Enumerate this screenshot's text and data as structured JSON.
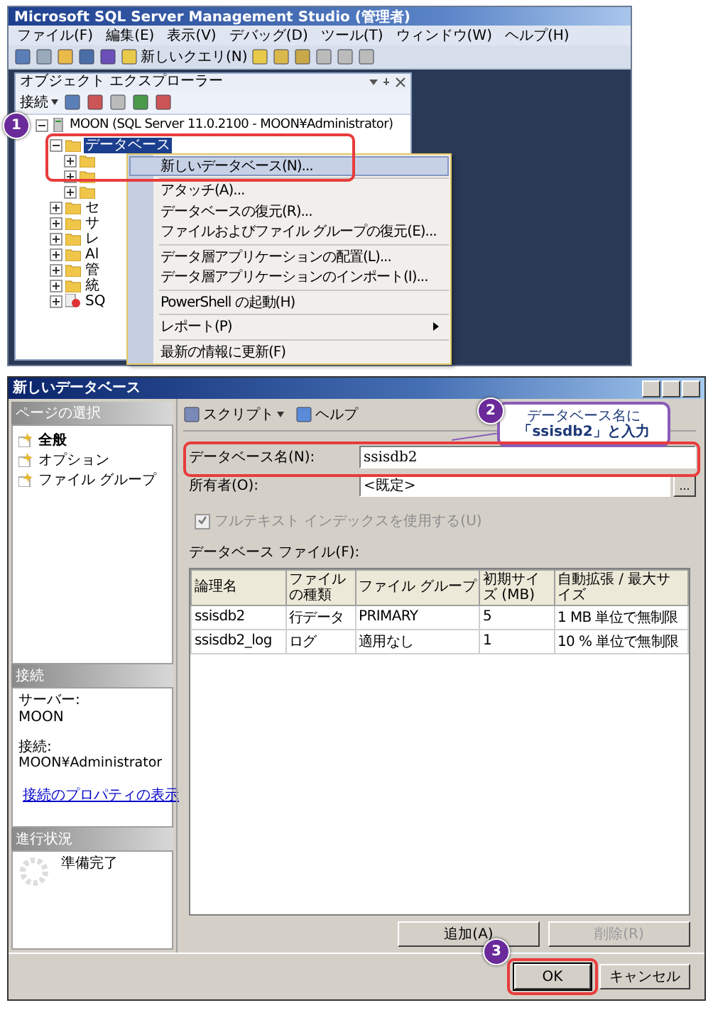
{
  "ssms": {
    "title": "Microsoft SQL Server Management Studio (管理者)",
    "menu": [
      "ファイル(F)",
      "編集(E)",
      "表示(V)",
      "デバッグ(D)",
      "ツール(T)",
      "ウィンドウ(W)",
      "ヘルプ(H)"
    ],
    "new_query": "新しいクエリ(N)",
    "explorer": {
      "title": "オブジェクト エクスプローラー",
      "connect": "接続",
      "tree": {
        "label": "MOON (SQL Server 11.0.2100 - MOON¥Administrator)",
        "kind": "server",
        "expanded": true,
        "selected": false,
        "children": [
          {
            "label": "データベース",
            "kind": "folder",
            "expanded": true,
            "selected": true
          },
          {
            "label": "セ",
            "kind": "folder",
            "expanded": false,
            "selected": false
          },
          {
            "label": "サ",
            "kind": "folder",
            "expanded": false,
            "selected": false
          },
          {
            "label": "レ",
            "kind": "folder",
            "expanded": false,
            "selected": false
          },
          {
            "label": "Al",
            "kind": "folder",
            "expanded": false,
            "selected": false
          },
          {
            "label": "管",
            "kind": "folder",
            "expanded": false,
            "selected": false
          },
          {
            "label": "統",
            "kind": "folder",
            "expanded": false,
            "selected": false
          },
          {
            "label": "SQ",
            "kind": "agent",
            "expanded": false,
            "selected": false
          }
        ]
      }
    },
    "context_menu": [
      [
        {
          "label": "新しいデータベース(N)...",
          "selected": true,
          "submenu": false
        }
      ],
      [
        {
          "label": "アタッチ(A)...",
          "selected": false,
          "submenu": false
        },
        {
          "label": "データベースの復元(R)...",
          "selected": false,
          "submenu": false
        },
        {
          "label": "ファイルおよびファイル グループの復元(E)...",
          "selected": false,
          "submenu": false
        }
      ],
      [
        {
          "label": "データ層アプリケーションの配置(L)...",
          "selected": false,
          "submenu": false
        },
        {
          "label": "データ層アプリケーションのインポート(I)...",
          "selected": false,
          "submenu": false
        }
      ],
      [
        {
          "label": "PowerShell の起動(H)",
          "selected": false,
          "submenu": false
        }
      ],
      [
        {
          "label": "レポート(P)",
          "selected": false,
          "submenu": true
        }
      ],
      [
        {
          "label": "最新の情報に更新(F)",
          "selected": false,
          "submenu": false
        }
      ]
    ]
  },
  "dialog": {
    "title": "新しいデータベース",
    "pages_header": "ページの選択",
    "pages": [
      {
        "label": "全般",
        "selected": true
      },
      {
        "label": "オプション",
        "selected": false
      },
      {
        "label": "ファイル グループ",
        "selected": false
      }
    ],
    "toolbar": [
      {
        "label": "スクリプト",
        "dropdown": true
      },
      {
        "label": "ヘルプ",
        "dropdown": false
      }
    ],
    "fields": [
      {
        "label": "データベース名(N):",
        "value": "ssisdb2",
        "browse": false
      },
      {
        "label": "所有者(O):",
        "value": "<既定>",
        "browse": true
      }
    ],
    "browse_button": "...",
    "fulltext": {
      "label": "フルテキスト インデックスを使用する(U)",
      "checked": true,
      "disabled": true
    },
    "files_label": "データベース ファイル(F):",
    "columns": [
      "論理名",
      "ファイルの種類",
      "ファイル グループ",
      "初期サイズ (MB)",
      "自動拡張 / 最大サイズ"
    ],
    "rows": [
      [
        "ssisdb2",
        "行データ",
        "PRIMARY",
        "5",
        "1 MB 単位で無制限"
      ],
      [
        "ssisdb2_log",
        "ログ",
        "適用なし",
        "1",
        "10 % 単位で無制限"
      ]
    ],
    "add_button": {
      "label": "追加(A)",
      "disabled": false
    },
    "remove_button": {
      "label": "削除(R)",
      "disabled": true
    },
    "connection": {
      "header": "接続",
      "server_label": "サーバー:",
      "server": "MOON",
      "conn_label": "接続:",
      "conn": "MOON¥Administrator",
      "link": "接続のプロパティの表示"
    },
    "progress": {
      "header": "進行状況",
      "status": "準備完了"
    },
    "ok": "OK",
    "cancel": "キャンセル"
  },
  "callouts": [
    {
      "number": "1"
    },
    {
      "number": "2",
      "lines": [
        "データベース名に",
        "「ssisdb2」と入力"
      ]
    },
    {
      "number": "3"
    }
  ]
}
